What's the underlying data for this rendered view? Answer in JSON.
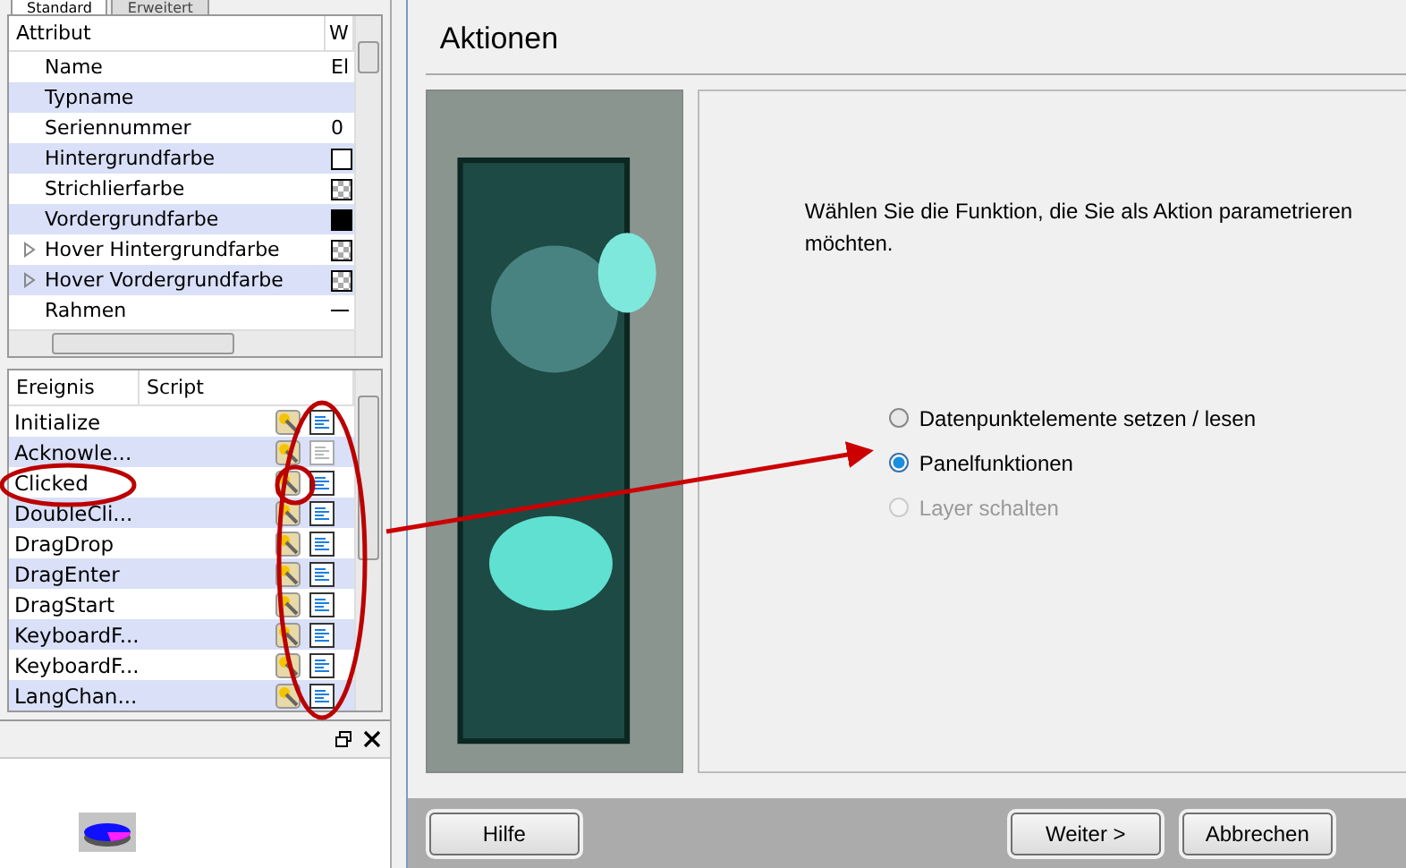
{
  "left_panel": {
    "tabs": [
      {
        "label": "Standard",
        "selected": true
      },
      {
        "label": "Erweitert",
        "selected": false
      }
    ],
    "attributes": {
      "columns": [
        "Attribut",
        "W"
      ],
      "rows": [
        {
          "name": "Name",
          "kind": "text",
          "value": "El",
          "expandable": false
        },
        {
          "name": "Typname",
          "kind": "empty",
          "expandable": false
        },
        {
          "name": "Seriennummer",
          "kind": "text",
          "value": "0",
          "expandable": false
        },
        {
          "name": "Hintergrundfarbe",
          "kind": "swatch",
          "color": "#ffffff",
          "expandable": false
        },
        {
          "name": "Strichlierfarbe",
          "kind": "pattern",
          "expandable": false
        },
        {
          "name": "Vordergrundfarbe",
          "kind": "swatch",
          "color": "#000000",
          "expandable": false
        },
        {
          "name": "Hover Hintergrundfarbe",
          "kind": "pattern",
          "expandable": true
        },
        {
          "name": "Hover Vordergrundfarbe",
          "kind": "pattern",
          "expandable": true
        },
        {
          "name": "Rahmen",
          "kind": "line",
          "expandable": false
        }
      ]
    },
    "events": {
      "columns": [
        "Ereignis",
        "Script"
      ],
      "rows": [
        {
          "name": "Initialize",
          "script": true
        },
        {
          "name": "Acknowle...",
          "script": false
        },
        {
          "name": "Clicked",
          "script": true
        },
        {
          "name": "DoubleCli...",
          "script": true
        },
        {
          "name": "DragDrop",
          "script": true
        },
        {
          "name": "DragEnter",
          "script": true
        },
        {
          "name": "DragStart",
          "script": true
        },
        {
          "name": "KeyboardF...",
          "script": true
        },
        {
          "name": "KeyboardF...",
          "script": true
        },
        {
          "name": "LangChan...",
          "script": true
        }
      ]
    }
  },
  "dialog": {
    "title": "Aktionen",
    "instruction": "Wählen Sie die Funktion, die Sie als Aktion parametrieren möchten.",
    "options": [
      {
        "label": "Datenpunktelemente setzen / lesen",
        "selected": false,
        "disabled": false
      },
      {
        "label": "Panelfunktionen",
        "selected": true,
        "disabled": false
      },
      {
        "label": "Layer schalten",
        "selected": false,
        "disabled": true
      }
    ],
    "buttons": [
      {
        "label": "Hilfe",
        "kind": "help"
      },
      {
        "label": "Weiter >",
        "kind": "nav"
      },
      {
        "label": "Abbrechen",
        "kind": "nav"
      }
    ]
  }
}
